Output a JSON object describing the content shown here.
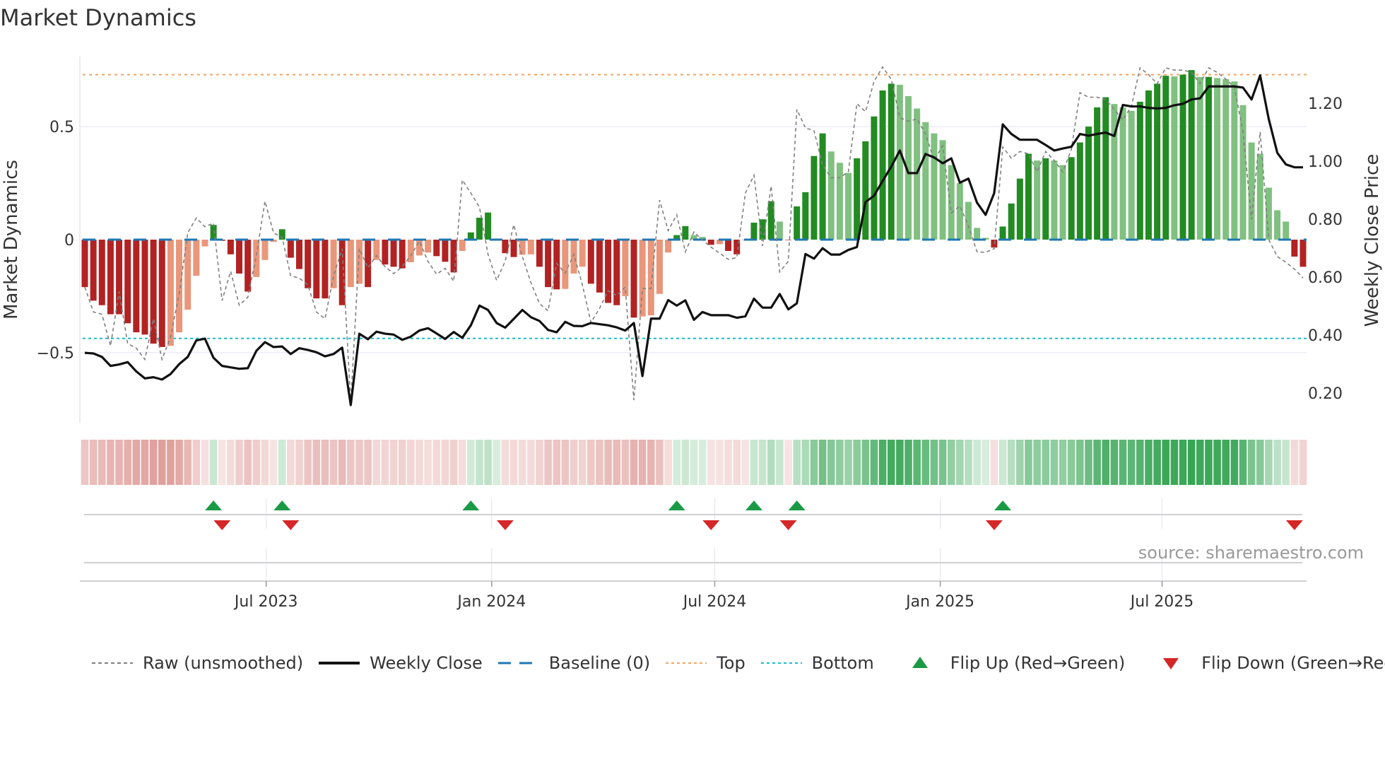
{
  "title": "Market Dynamics",
  "source": "source: sharemaestro.com",
  "chart_data": {
    "type": "bar",
    "title": "Market Dynamics",
    "ylabel": "Market Dynamics",
    "y2label": "Weekly Close Price",
    "frequency": "weekly",
    "start_date": "2023-02-03",
    "end_date": "2025-10-24",
    "ylim": [
      -0.81,
      0.81
    ],
    "y2lim": [
      0.098,
      1.361
    ],
    "yticks": [
      {
        "v": 0.5,
        "label": "0.5"
      },
      {
        "v": 0,
        "label": "0"
      },
      {
        "v": -0.5,
        "label": "−0.5"
      }
    ],
    "y2ticks": [
      {
        "v": 1.2,
        "label": "1.20"
      },
      {
        "v": 1.0,
        "label": "1.00"
      },
      {
        "v": 0.8,
        "label": "0.80"
      },
      {
        "v": 0.6,
        "label": "0.60"
      },
      {
        "v": 0.4,
        "label": "0.40"
      },
      {
        "v": 0.2,
        "label": "0.20"
      }
    ],
    "xticks": [
      {
        "date": "2023-07-01",
        "label": "Jul 2023"
      },
      {
        "date": "2024-01-01",
        "label": "Jan 2024"
      },
      {
        "date": "2024-07-01",
        "label": "Jul 2024"
      },
      {
        "date": "2025-01-01",
        "label": "Jan 2025"
      },
      {
        "date": "2025-07-01",
        "label": "Jul 2025"
      }
    ],
    "top_level": 0.73,
    "bottom_level": -0.437,
    "baseline": 0,
    "colors": {
      "dark_red": "#b22222",
      "light_red": "#e9967a",
      "dark_green": "#228b22",
      "light_green": "#80c080",
      "raw": "#808080",
      "close": "#111111",
      "baseline": "#1f77b4",
      "top": "#f4a460",
      "bottom": "#17becf",
      "flip_up": "#1a9a45",
      "flip_down": "#d62728"
    },
    "smoothed": [
      -0.21,
      -0.27,
      -0.29,
      -0.33,
      -0.33,
      -0.37,
      -0.41,
      -0.42,
      -0.46,
      -0.475,
      -0.47,
      -0.41,
      -0.31,
      -0.16,
      -0.03,
      0.065,
      -0.005,
      -0.065,
      -0.15,
      -0.23,
      -0.165,
      -0.09,
      -0.01,
      0.046,
      -0.08,
      -0.13,
      -0.215,
      -0.26,
      -0.26,
      -0.215,
      -0.29,
      -0.21,
      -0.195,
      -0.21,
      -0.09,
      -0.11,
      -0.12,
      -0.127,
      -0.1,
      -0.07,
      -0.057,
      -0.073,
      -0.098,
      -0.145,
      -0.05,
      0.032,
      0.097,
      0.12,
      0.005,
      -0.06,
      -0.077,
      -0.067,
      -0.065,
      -0.12,
      -0.21,
      -0.22,
      -0.218,
      -0.15,
      -0.12,
      -0.195,
      -0.234,
      -0.28,
      -0.29,
      -0.25,
      -0.345,
      -0.34,
      -0.335,
      -0.24,
      -0.057,
      0.02,
      0.06,
      0.02,
      0.012,
      -0.023,
      -0.02,
      -0.05,
      -0.065,
      -0.003,
      0.075,
      0.09,
      0.17,
      0.08,
      -0.002,
      0.147,
      0.21,
      0.37,
      0.47,
      0.39,
      0.34,
      0.295,
      0.36,
      0.435,
      0.545,
      0.66,
      0.69,
      0.685,
      0.635,
      0.58,
      0.52,
      0.47,
      0.44,
      0.33,
      0.25,
      0.167,
      0.052,
      0.008,
      -0.035,
      0.058,
      0.16,
      0.27,
      0.38,
      0.35,
      0.36,
      0.35,
      0.33,
      0.365,
      0.43,
      0.5,
      0.585,
      0.63,
      0.6,
      0.585,
      0.57,
      0.61,
      0.66,
      0.69,
      0.725,
      0.722,
      0.73,
      0.75,
      0.72,
      0.72,
      0.715,
      0.71,
      0.7,
      0.595,
      0.43,
      0.38,
      0.23,
      0.13,
      0.08,
      -0.075,
      -0.12
    ],
    "raw": [
      -0.21,
      -0.32,
      -0.33,
      -0.47,
      -0.23,
      -0.46,
      -0.48,
      -0.53,
      -0.35,
      -0.53,
      -0.43,
      -0.24,
      0.03,
      0.096,
      0.057,
      0.073,
      -0.27,
      -0.14,
      -0.29,
      -0.255,
      -0.07,
      0.17,
      0.03,
      0.01,
      -0.16,
      -0.17,
      -0.2,
      -0.32,
      -0.35,
      -0.16,
      -0.04,
      -0.72,
      -0.04,
      -0.125,
      -0.07,
      -0.12,
      -0.15,
      -0.12,
      -0.07,
      -0.007,
      -0.096,
      -0.153,
      -0.127,
      -0.184,
      0.264,
      0.206,
      0.144,
      -0.065,
      -0.18,
      -0.096,
      0.066,
      -0.075,
      -0.19,
      -0.283,
      -0.315,
      -0.106,
      -0.148,
      -0.065,
      -0.2,
      -0.367,
      -0.304,
      -0.226,
      -0.247,
      -0.21,
      -0.71,
      -0.216,
      -0.216,
      0.175,
      0.04,
      0.11,
      -0.054,
      0.034,
      -0.002,
      -0.033,
      -0.06,
      -0.087,
      -0.08,
      0.206,
      0.285,
      -0.028,
      0.237,
      -0.143,
      -0.096,
      0.576,
      0.494,
      0.482,
      0.33,
      0.274,
      0.274,
      0.3,
      0.602,
      0.566,
      0.7,
      0.764,
      0.71,
      0.54,
      0.524,
      0.534,
      0.467,
      0.352,
      0.415,
      0.118,
      0.149,
      0.06,
      -0.054,
      -0.056,
      -0.04,
      0.41,
      0.36,
      0.39,
      0.38,
      0.3,
      0.39,
      0.35,
      0.3,
      0.4,
      0.65,
      0.63,
      0.63,
      0.62,
      0.576,
      0.53,
      0.59,
      0.76,
      0.73,
      0.69,
      0.76,
      0.75,
      0.75,
      0.74,
      0.69,
      0.76,
      0.74,
      0.71,
      0.675,
      0.477,
      0.09,
      0.477,
      0.0,
      -0.075,
      -0.1,
      -0.13,
      -0.17
    ],
    "close": [
      0.339,
      0.337,
      0.325,
      0.294,
      0.299,
      0.307,
      0.275,
      0.251,
      0.255,
      0.247,
      0.266,
      0.3,
      0.325,
      0.382,
      0.388,
      0.322,
      0.294,
      0.289,
      0.284,
      0.286,
      0.346,
      0.376,
      0.359,
      0.361,
      0.335,
      0.355,
      0.349,
      0.341,
      0.327,
      0.335,
      0.357,
      0.159,
      0.405,
      0.386,
      0.412,
      0.405,
      0.402,
      0.384,
      0.395,
      0.416,
      0.424,
      0.406,
      0.387,
      0.411,
      0.391,
      0.434,
      0.502,
      0.487,
      0.442,
      0.426,
      0.456,
      0.487,
      0.462,
      0.449,
      0.418,
      0.41,
      0.446,
      0.432,
      0.431,
      0.442,
      0.438,
      0.434,
      0.427,
      0.416,
      0.442,
      0.259,
      0.457,
      0.457,
      0.521,
      0.502,
      0.52,
      0.453,
      0.48,
      0.469,
      0.469,
      0.469,
      0.46,
      0.465,
      0.526,
      0.495,
      0.495,
      0.542,
      0.489,
      0.51,
      0.68,
      0.664,
      0.7,
      0.678,
      0.678,
      0.694,
      0.704,
      0.859,
      0.881,
      0.932,
      0.981,
      1.037,
      0.959,
      0.959,
      1.025,
      1.013,
      0.993,
      1.01,
      0.926,
      0.94,
      0.857,
      0.815,
      0.89,
      1.127,
      1.094,
      1.074,
      1.074,
      1.074,
      1.056,
      1.037,
      1.044,
      1.05,
      1.094,
      1.088,
      1.094,
      1.099,
      1.087,
      1.194,
      1.189,
      1.189,
      1.184,
      1.182,
      1.184,
      1.193,
      1.198,
      1.213,
      1.217,
      1.258,
      1.258,
      1.258,
      1.258,
      1.254,
      1.213,
      1.296,
      1.146,
      1.029,
      0.989,
      0.979,
      0.979
    ],
    "flip_up_dates": [
      "2023-05-19",
      "2023-07-14",
      "2023-12-15",
      "2024-05-31",
      "2024-08-02",
      "2024-09-06",
      "2025-02-21"
    ],
    "flip_down_dates": [
      "2023-05-26",
      "2023-07-21",
      "2024-01-12",
      "2024-06-28",
      "2024-08-30",
      "2025-02-14",
      "2025-10-17"
    ],
    "legend": [
      {
        "key": "raw",
        "label": "Raw (unsmoothed)"
      },
      {
        "key": "close",
        "label": "Weekly Close"
      },
      {
        "key": "baseline",
        "label": "Baseline (0)"
      },
      {
        "key": "top",
        "label": "Top"
      },
      {
        "key": "bottom",
        "label": "Bottom"
      },
      {
        "key": "flip_up",
        "label": "Flip Up (Red→Green)"
      },
      {
        "key": "flip_down",
        "label": "Flip Down (Green→Red)"
      }
    ],
    "legend_position": "bottom"
  }
}
